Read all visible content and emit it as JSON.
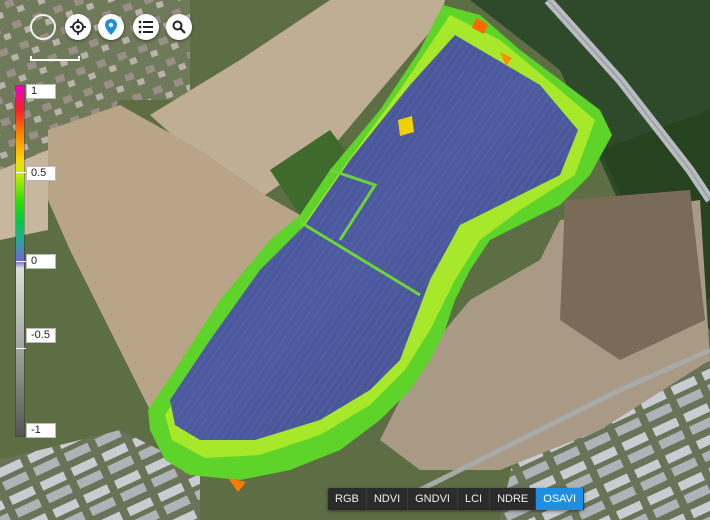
{
  "toolbar": {
    "buttons": [
      {
        "icon": "circle-outline-icon"
      },
      {
        "icon": "crosshair-locate-icon"
      },
      {
        "icon": "map-pin-icon"
      },
      {
        "icon": "list-icon"
      },
      {
        "icon": "search-icon"
      }
    ]
  },
  "legend": {
    "labels": [
      "1",
      "0.5",
      "0",
      "-0.5",
      "-1"
    ],
    "max": 1,
    "min": -1
  },
  "indices": {
    "items": [
      "RGB",
      "NDVI",
      "GNDVI",
      "LCI",
      "NDRE",
      "OSAVI"
    ],
    "active": "OSAVI"
  },
  "colors": {
    "accent": "#1e8fe0",
    "pin": "#1e8fe0"
  }
}
